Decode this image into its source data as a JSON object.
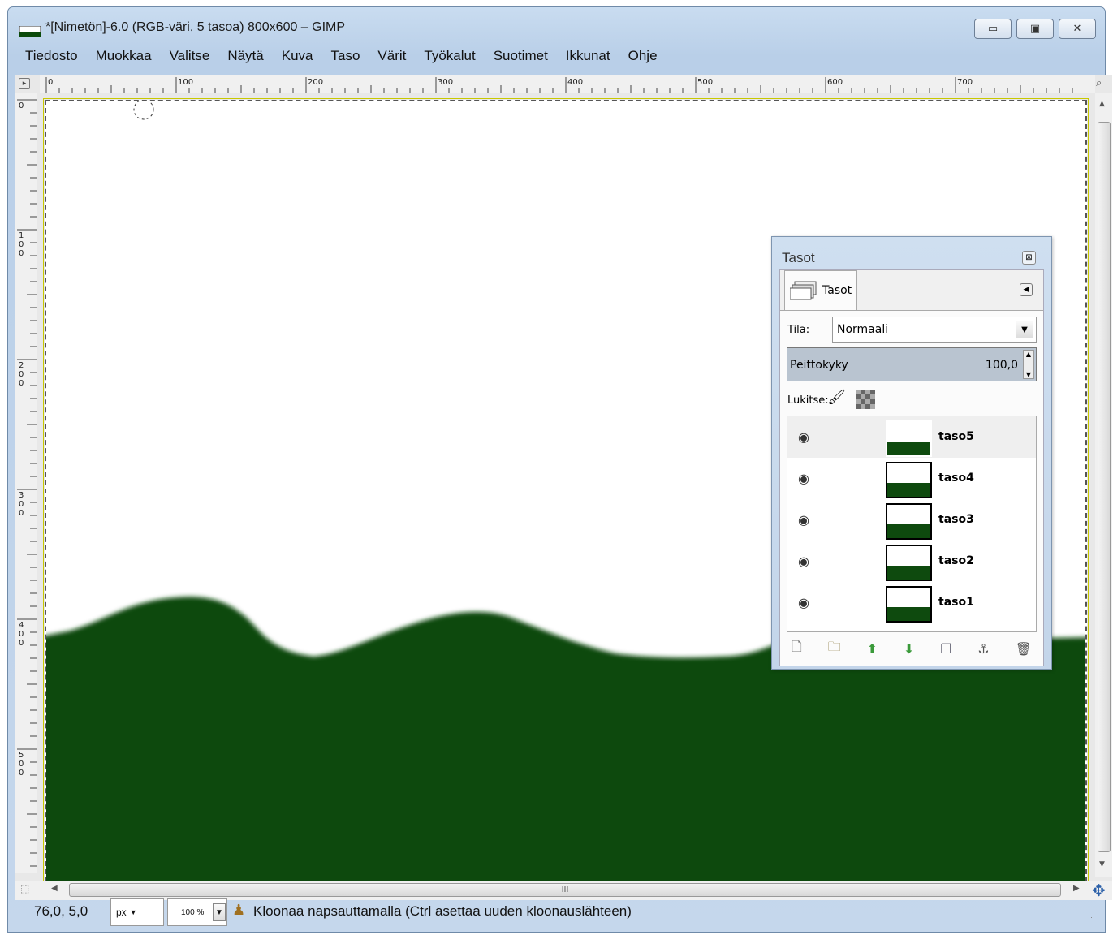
{
  "window": {
    "title": "*[Nimetön]-6.0 (RGB-väri, 5 tasoa) 800x600 – GIMP",
    "minimize_symbol": "▭",
    "maximize_symbol": "▣",
    "close_symbol": "✕"
  },
  "menubar": [
    {
      "label": "Tiedosto"
    },
    {
      "label": "Muokkaa"
    },
    {
      "label": "Valitse"
    },
    {
      "label": "Näytä"
    },
    {
      "label": "Kuva"
    },
    {
      "label": "Taso"
    },
    {
      "label": "Värit"
    },
    {
      "label": "Työkalut"
    },
    {
      "label": "Suotimet"
    },
    {
      "label": "Ikkunat"
    },
    {
      "label": "Ohje"
    }
  ],
  "ruler": {
    "h_labels": [
      "0",
      "100",
      "200",
      "300",
      "400",
      "500",
      "600",
      "700"
    ],
    "v_labels": [
      "0",
      "1\n0\n0",
      "2\n0\n0",
      "3\n0\n0",
      "4\n0\n0",
      "5\n0\n0"
    ]
  },
  "canvas": {
    "ground_color": "#0b4a0b",
    "background_color": "#ffffff"
  },
  "layers_dock": {
    "title": "Tasot",
    "tab_label": "Tasot",
    "mode_label": "Tila:",
    "mode_value": "Normaali",
    "opacity_label": "Peittokyky",
    "opacity_value": "100,0",
    "lock_label": "Lukitse:",
    "layers": [
      {
        "name": "taso5",
        "selected": true,
        "visible": true
      },
      {
        "name": "taso4",
        "selected": false,
        "visible": true
      },
      {
        "name": "taso3",
        "selected": false,
        "visible": true
      },
      {
        "name": "taso2",
        "selected": false,
        "visible": true
      },
      {
        "name": "taso1",
        "selected": false,
        "visible": true
      }
    ]
  },
  "status": {
    "coords": "76,0, 5,0",
    "unit": "px",
    "zoom": "100 %",
    "message": "Kloonaa napsauttamalla (Ctrl asettaa uuden kloonauslähteen)"
  },
  "scrollbar": {
    "grip": "III"
  }
}
